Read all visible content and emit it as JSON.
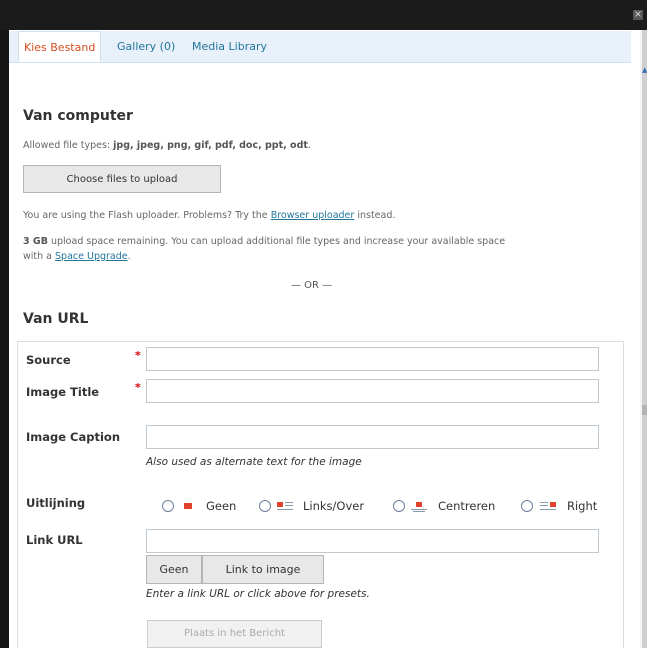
{
  "window": {
    "close_symbol": "×"
  },
  "tabs": [
    {
      "label": "Kies Bestand",
      "active": true
    },
    {
      "label": "Gallery (0)",
      "active": false
    },
    {
      "label": "Media Library",
      "active": false
    }
  ],
  "from_computer": {
    "heading": "Van computer",
    "allowed_prefix": "Allowed file types: ",
    "allowed_types": "jpg, jpeg, png, gif, pdf, doc, ppt, odt",
    "allowed_suffix": ".",
    "choose_button": "Choose files to upload",
    "flash_prefix": "You are using the Flash uploader. Problems? Try the ",
    "flash_link": "Browser uploader",
    "flash_suffix": " instead.",
    "space_amount": "3 GB",
    "space_text": " upload space remaining. You can upload additional file types and increase your available space",
    "space_line2_prefix": "with a ",
    "space_link": "Space Upgrade",
    "space_line2_suffix": "."
  },
  "or_separator": "— OR —",
  "from_url": {
    "heading": "Van URL",
    "required_marker": "*",
    "source_label": "Source",
    "source_value": "",
    "title_label": "Image Title",
    "title_value": "",
    "caption_label": "Image Caption",
    "caption_value": "",
    "caption_help": "Also used as alternate text for the image",
    "alignment_label": "Uitlijning",
    "alignment_options": [
      "Geen",
      "Links/Over",
      "Centreren",
      "Right"
    ],
    "link_label": "Link URL",
    "link_value": "",
    "link_none_button": "Geen",
    "link_image_button": "Link to image",
    "link_help": "Enter a link URL or click above for presets.",
    "insert_button": "Plaats in het Bericht"
  },
  "colors": {
    "accent_tab": "#d54e21",
    "link": "#21759b",
    "required": "#cc0000",
    "icon_red": "#e0432b"
  }
}
